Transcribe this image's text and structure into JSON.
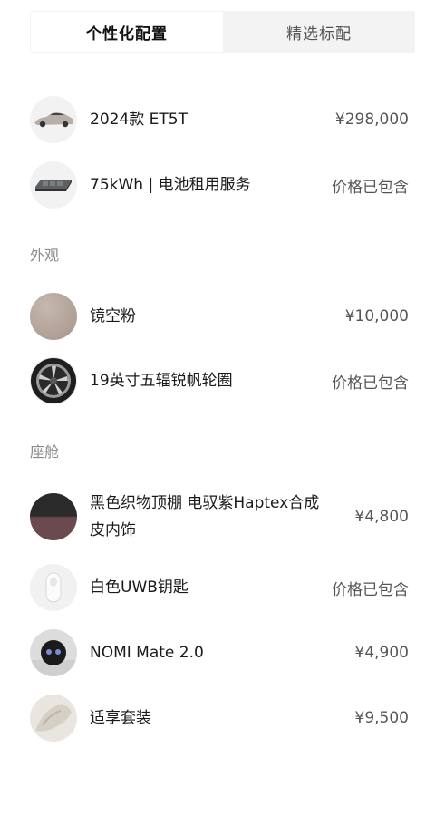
{
  "tabs": [
    {
      "label": "个性化配置",
      "active": true
    },
    {
      "label": "精选标配",
      "active": false
    }
  ],
  "base": [
    {
      "name": "2024款 ET5T",
      "price": "¥298,000",
      "icon": "car-thumbnail"
    },
    {
      "name": "75kWh | 电池租用服务",
      "price": "价格已包含",
      "icon": "battery-thumbnail"
    }
  ],
  "exterior": {
    "title": "外观",
    "items": [
      {
        "name": "镜空粉",
        "price": "¥10,000",
        "icon": "paint-swatch"
      },
      {
        "name": "19英寸五辐锐帆轮圈",
        "price": "价格已包含",
        "icon": "wheel-thumbnail"
      }
    ]
  },
  "cabin": {
    "title": "座舱",
    "items": [
      {
        "name": "黑色织物顶棚 电驭紫Haptex合成皮内饰",
        "price": "¥4,800",
        "icon": "interior-swatch"
      },
      {
        "name": "白色UWB钥匙",
        "price": "价格已包含",
        "icon": "key-thumbnail"
      },
      {
        "name": "NOMI Mate 2.0",
        "price": "¥4,900",
        "icon": "nomi-thumbnail"
      },
      {
        "name": "适享套装",
        "price": "¥9,500",
        "icon": "comfort-package-thumbnail"
      }
    ]
  },
  "colors": {
    "pink_swatch": "#b3a398",
    "interior_top": "#2a2a2a",
    "interior_bottom": "#6b4a4f"
  }
}
